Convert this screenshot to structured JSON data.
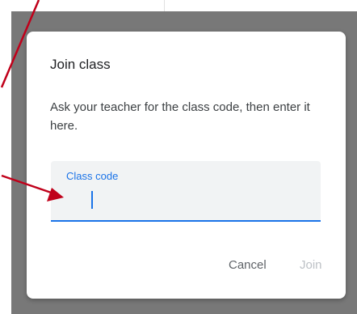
{
  "dialog": {
    "title": "Join class",
    "description": "Ask your teacher for the class code, then enter it here.",
    "field": {
      "label": "Class code",
      "value": "",
      "placeholder": ""
    },
    "cancel_label": "Cancel",
    "join_label": "Join"
  },
  "colors": {
    "accent": "#1a73e8",
    "annotation_arrow": "#c0001a",
    "scrim": "#787878",
    "disabled_text": "#bdc1c6"
  },
  "annotations": {
    "arrows": [
      "arrow-from-top",
      "arrow-to-field"
    ]
  }
}
